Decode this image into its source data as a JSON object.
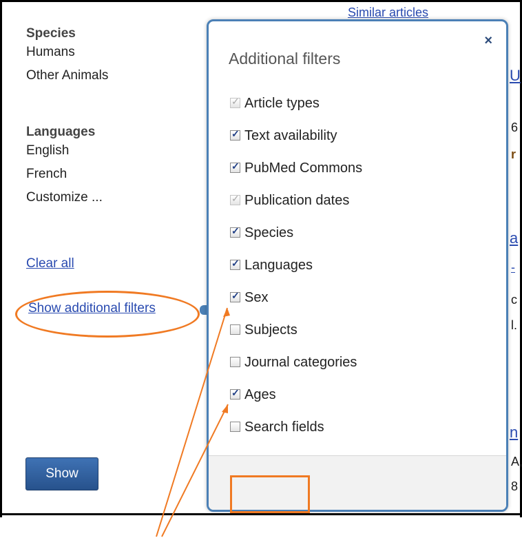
{
  "sidebar": {
    "species_heading": "Species",
    "species_items": [
      "Humans",
      "Other Animals"
    ],
    "languages_heading": "Languages",
    "language_items": [
      "English",
      "French",
      "Customize ..."
    ],
    "clear_all": "Clear all",
    "show_additional_filters": "Show additional filters"
  },
  "background": {
    "similar_articles": "Similar articles",
    "fragments": [
      "U",
      "6",
      "r",
      "a",
      "-",
      "c",
      "l.",
      "n",
      "A,",
      "8"
    ]
  },
  "popup": {
    "title": "Additional filters",
    "close": "×",
    "options": [
      {
        "label": "Article types",
        "checked": true,
        "disabled": true
      },
      {
        "label": "Text availability",
        "checked": true,
        "disabled": false
      },
      {
        "label": "PubMed Commons",
        "checked": true,
        "disabled": false
      },
      {
        "label": "Publication dates",
        "checked": true,
        "disabled": true
      },
      {
        "label": "Species",
        "checked": true,
        "disabled": false
      },
      {
        "label": "Languages",
        "checked": true,
        "disabled": false
      },
      {
        "label": "Sex",
        "checked": true,
        "disabled": false
      },
      {
        "label": "Subjects",
        "checked": false,
        "disabled": false
      },
      {
        "label": "Journal categories",
        "checked": false,
        "disabled": false
      },
      {
        "label": "Ages",
        "checked": true,
        "disabled": false
      },
      {
        "label": "Search fields",
        "checked": false,
        "disabled": false
      }
    ],
    "show_button": "Show"
  },
  "colors": {
    "annotation": "#f07a23",
    "popup_border": "#4b80b6",
    "link": "#2a4bb0",
    "button": "#2f5f9e"
  }
}
